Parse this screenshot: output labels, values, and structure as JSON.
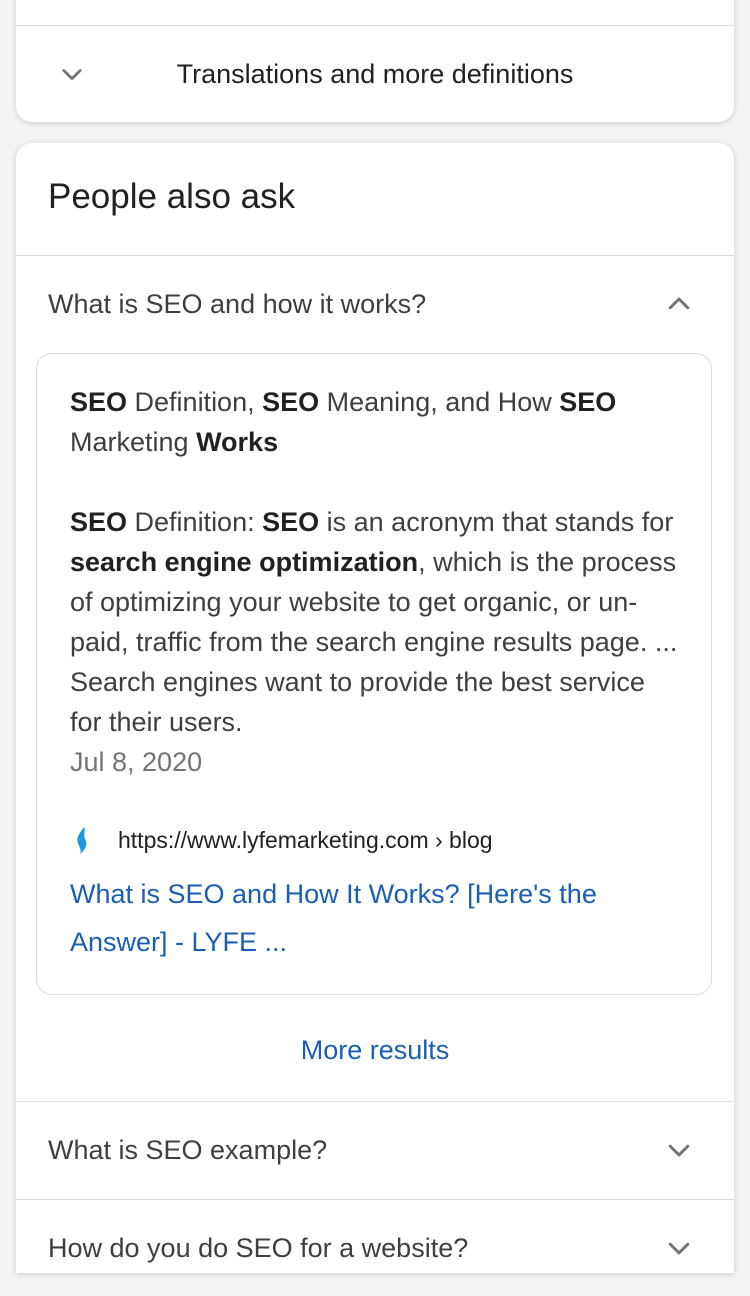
{
  "translations": {
    "label": "Translations and more definitions"
  },
  "paa": {
    "title": "People also ask",
    "questions": [
      {
        "text": "What is SEO and how it works?"
      },
      {
        "text": "What is SEO example?"
      },
      {
        "text": "How do you do SEO for a website?"
      }
    ],
    "answer": {
      "heading_parts": [
        "SEO",
        " Definition, ",
        "SEO",
        " Meaning, and How ",
        "SEO",
        " Marketing ",
        "Works"
      ],
      "body_parts": [
        "SEO",
        " Definition: ",
        "SEO",
        " is an acronym that stands for ",
        "search engine optimization",
        ", which is the process of optimizing your website to get organic, or un-paid, traffic from the search engine results page. ... Search engines want to provide the best service for their users."
      ],
      "date": "Jul 8, 2020",
      "source_url": "https://www.lyfemarketing.com › blog",
      "link_title": "What is SEO and How It Works? [Here's the Answer] - LYFE ..."
    },
    "more_results": "More results"
  },
  "colors": {
    "link": "#1a5fb4",
    "divider": "#dadce0",
    "favicon": "#1a9be0"
  }
}
